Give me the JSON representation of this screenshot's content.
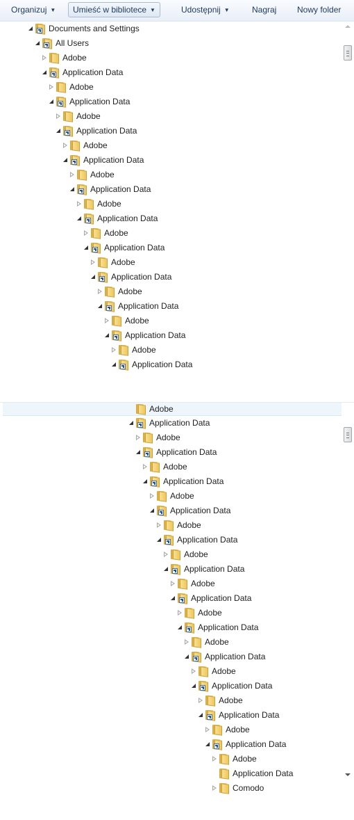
{
  "toolbar": {
    "organize": "Organizuj",
    "include_in_library": "Umieść w bibliotece",
    "share": "Udostępnij",
    "burn": "Nagraj",
    "new_folder": "Nowy folder"
  },
  "pane1_rows": [
    {
      "depth": 0,
      "label": "Documents and Settings",
      "expander": "open",
      "shortcut": true
    },
    {
      "depth": 1,
      "label": "All Users",
      "expander": "open",
      "shortcut": true
    },
    {
      "depth": 2,
      "label": "Adobe",
      "expander": "closed",
      "shortcut": false
    },
    {
      "depth": 2,
      "label": "Application Data",
      "expander": "open",
      "shortcut": true
    },
    {
      "depth": 3,
      "label": "Adobe",
      "expander": "closed",
      "shortcut": false
    },
    {
      "depth": 3,
      "label": "Application Data",
      "expander": "open",
      "shortcut": true
    },
    {
      "depth": 4,
      "label": "Adobe",
      "expander": "closed",
      "shortcut": false
    },
    {
      "depth": 4,
      "label": "Application Data",
      "expander": "open",
      "shortcut": true
    },
    {
      "depth": 5,
      "label": "Adobe",
      "expander": "closed",
      "shortcut": false
    },
    {
      "depth": 5,
      "label": "Application Data",
      "expander": "open",
      "shortcut": true
    },
    {
      "depth": 6,
      "label": "Adobe",
      "expander": "closed",
      "shortcut": false
    },
    {
      "depth": 6,
      "label": "Application Data",
      "expander": "open",
      "shortcut": true
    },
    {
      "depth": 7,
      "label": "Adobe",
      "expander": "closed",
      "shortcut": false
    },
    {
      "depth": 7,
      "label": "Application Data",
      "expander": "open",
      "shortcut": true
    },
    {
      "depth": 8,
      "label": "Adobe",
      "expander": "closed",
      "shortcut": false
    },
    {
      "depth": 8,
      "label": "Application Data",
      "expander": "open",
      "shortcut": true
    },
    {
      "depth": 9,
      "label": "Adobe",
      "expander": "closed",
      "shortcut": false
    },
    {
      "depth": 9,
      "label": "Application Data",
      "expander": "open",
      "shortcut": true
    },
    {
      "depth": 10,
      "label": "Adobe",
      "expander": "closed",
      "shortcut": false
    },
    {
      "depth": 10,
      "label": "Application Data",
      "expander": "open",
      "shortcut": true
    },
    {
      "depth": 11,
      "label": "Adobe",
      "expander": "closed",
      "shortcut": false
    },
    {
      "depth": 11,
      "label": "Application Data",
      "expander": "open",
      "shortcut": true
    },
    {
      "depth": 12,
      "label": "Adobe",
      "expander": "closed",
      "shortcut": false
    },
    {
      "depth": 12,
      "label": "Application Data",
      "expander": "open",
      "shortcut": true
    }
  ],
  "pane2_rows": [
    {
      "depth": 0,
      "label": "Adobe",
      "expander": "none",
      "shortcut": false,
      "selected": true
    },
    {
      "depth": 0,
      "label": "Application Data",
      "expander": "open",
      "shortcut": true
    },
    {
      "depth": 1,
      "label": "Adobe",
      "expander": "closed",
      "shortcut": false
    },
    {
      "depth": 1,
      "label": "Application Data",
      "expander": "open",
      "shortcut": true
    },
    {
      "depth": 2,
      "label": "Adobe",
      "expander": "closed",
      "shortcut": false
    },
    {
      "depth": 2,
      "label": "Application Data",
      "expander": "open",
      "shortcut": true
    },
    {
      "depth": 3,
      "label": "Adobe",
      "expander": "closed",
      "shortcut": false
    },
    {
      "depth": 3,
      "label": "Application Data",
      "expander": "open",
      "shortcut": true
    },
    {
      "depth": 4,
      "label": "Adobe",
      "expander": "closed",
      "shortcut": false
    },
    {
      "depth": 4,
      "label": "Application Data",
      "expander": "open",
      "shortcut": true
    },
    {
      "depth": 5,
      "label": "Adobe",
      "expander": "closed",
      "shortcut": false
    },
    {
      "depth": 5,
      "label": "Application Data",
      "expander": "open",
      "shortcut": true
    },
    {
      "depth": 6,
      "label": "Adobe",
      "expander": "closed",
      "shortcut": false
    },
    {
      "depth": 6,
      "label": "Application Data",
      "expander": "open",
      "shortcut": true
    },
    {
      "depth": 7,
      "label": "Adobe",
      "expander": "closed",
      "shortcut": false
    },
    {
      "depth": 7,
      "label": "Application Data",
      "expander": "open",
      "shortcut": true
    },
    {
      "depth": 8,
      "label": "Adobe",
      "expander": "closed",
      "shortcut": false
    },
    {
      "depth": 8,
      "label": "Application Data",
      "expander": "open",
      "shortcut": true
    },
    {
      "depth": 9,
      "label": "Adobe",
      "expander": "closed",
      "shortcut": false
    },
    {
      "depth": 9,
      "label": "Application Data",
      "expander": "open",
      "shortcut": true
    },
    {
      "depth": 10,
      "label": "Adobe",
      "expander": "closed",
      "shortcut": false
    },
    {
      "depth": 10,
      "label": "Application Data",
      "expander": "open",
      "shortcut": true
    },
    {
      "depth": 11,
      "label": "Adobe",
      "expander": "closed",
      "shortcut": false
    },
    {
      "depth": 11,
      "label": "Application Data",
      "expander": "open",
      "shortcut": true
    },
    {
      "depth": 12,
      "label": "Adobe",
      "expander": "closed",
      "shortcut": false
    },
    {
      "depth": 12,
      "label": "Application Data",
      "expander": "none",
      "shortcut": false
    },
    {
      "depth": 12,
      "label": "Comodo",
      "expander": "closed",
      "shortcut": false
    }
  ],
  "colors": {
    "toolbar_text": "#1e395b",
    "selection_bg": "#eef6fc",
    "folder": "#efc659"
  },
  "icons": {
    "expanded": "triangle-down-icon",
    "collapsed": "triangle-right-icon",
    "folder": "folder-icon",
    "shortcut": "shortcut-arrow-icon"
  }
}
